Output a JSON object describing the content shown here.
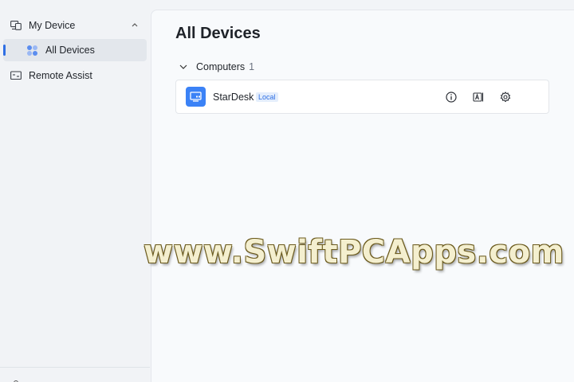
{
  "sidebar": {
    "items": [
      {
        "label": "My Device",
        "icon": "devices-icon",
        "expanded": true
      },
      {
        "label": "All Devices",
        "icon": "grid-dots-icon",
        "selected": true
      },
      {
        "label": "Remote Assist",
        "icon": "remote-assist-icon"
      }
    ]
  },
  "main": {
    "title": "All Devices",
    "group": {
      "label": "Computers",
      "count": "1",
      "expanded": true
    },
    "devices": [
      {
        "name": "StarDesk",
        "badge": "Local",
        "actions": [
          "info-icon",
          "rename-icon",
          "settings-icon"
        ]
      }
    ]
  },
  "watermark": "www.SwiftPCApps.com",
  "colors": {
    "accent": "#2f6fe4",
    "device_icon_bg": "#3b82f6",
    "selected_bg": "#e3e7ec"
  }
}
